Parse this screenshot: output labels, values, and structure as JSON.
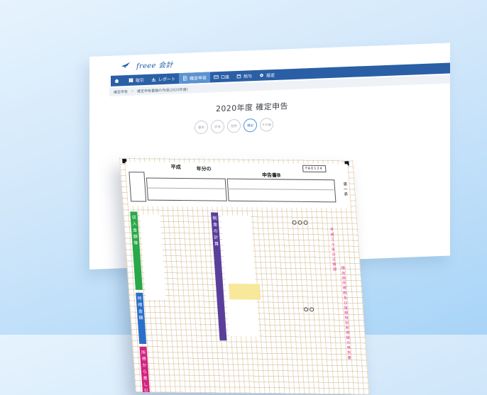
{
  "app": {
    "logo_text": "freee 会計"
  },
  "nav": {
    "items": [
      {
        "label": "取引",
        "icon": "book-icon",
        "active": false
      },
      {
        "label": "レポート",
        "icon": "chart-icon",
        "active": false
      },
      {
        "label": "確定申告",
        "icon": "document-icon",
        "active": true
      },
      {
        "label": "口座",
        "icon": "card-icon",
        "active": false
      },
      {
        "label": "給与",
        "icon": "calendar-icon",
        "active": false
      },
      {
        "label": "設定",
        "icon": "gear-icon",
        "active": false
      }
    ]
  },
  "breadcrumb": {
    "root": "確定申告",
    "separator": "»",
    "current": "確定申告書類の作成(2020年度)"
  },
  "page": {
    "title": "2020年度 確定申告"
  },
  "steps": [
    {
      "label": "基本",
      "active": false
    },
    {
      "label": "収支",
      "active": false
    },
    {
      "label": "控除",
      "active": false
    },
    {
      "label": "提出",
      "active": true
    },
    {
      "label": "その後",
      "active": false
    }
  ],
  "form": {
    "heisei": "平成",
    "nenbun": "年分の",
    "shinkoku": "申告書B",
    "code": "FA0124",
    "daiichi": "第一表",
    "label_income": "収入金額等",
    "label_tax": "税金の計算",
    "label_shotoku": "所得金額",
    "label_kojo": "所得から差し引かれる金額",
    "pink_note_1": "平成三十年分以降用",
    "pink_note_2": "提出用所得税及び復興特別所得税の申告書"
  },
  "colors": {
    "nav_bg": "#2a5fa6",
    "nav_active": "#5b92d1",
    "green": "#29a84a",
    "blue": "#2a6ec9",
    "purple": "#5a3f9a",
    "magenta": "#d2237f",
    "pink_note": "#e0238a",
    "brand": "#1e5fa8"
  }
}
